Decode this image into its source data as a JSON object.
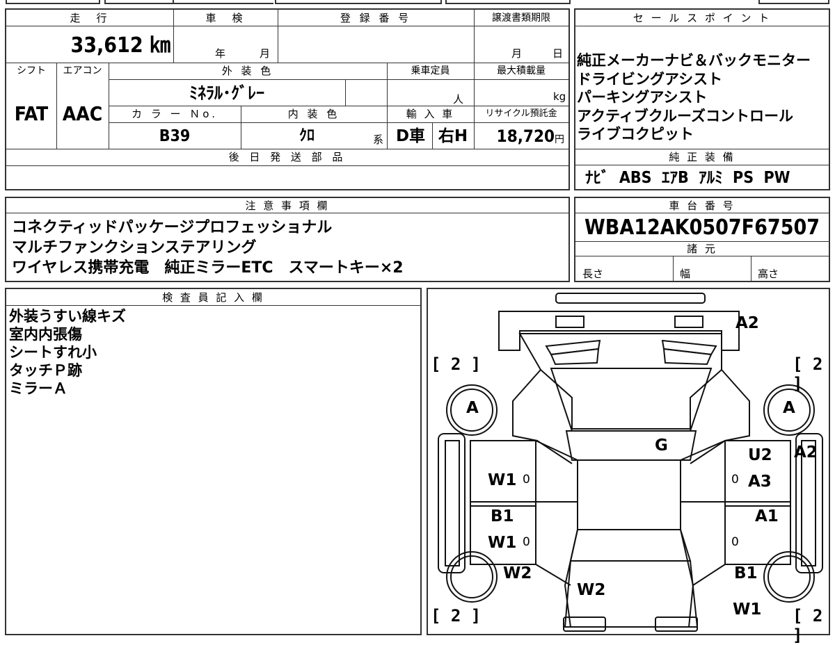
{
  "top_strip": {
    "fragment_a": "",
    "fragment_b": ""
  },
  "vehicle": {
    "mileage_label": "走　行",
    "mileage": "33,612 ㎞",
    "shaken_label": "車　検",
    "shaken_year_unit": "年",
    "shaken_month_unit": "月",
    "reg_label": "登 録 番 号",
    "transfer_label": "譲渡書類期限",
    "transfer_month_unit": "月",
    "transfer_day_unit": "日",
    "shift_label": "シフト",
    "ac_label": "エアコン",
    "ext_color_label": "外 装 色",
    "capacity_label": "乗車定員",
    "max_load_label": "最大積載量",
    "shift": "FAT",
    "ac": "AAC",
    "ext_color": "ﾐﾈﾗﾙ･ｸﾞﾚｰ",
    "capacity_unit": "人",
    "load_unit": "kg",
    "color_no_label": "カ ラ ー Ｎo.",
    "int_color_label": "内 装 色",
    "import_label": "輸 入 車",
    "recycle_label": "リサイクル預託金",
    "color_no": "B39",
    "int_color": "ｸﾛ",
    "int_color_suffix": "系",
    "import_type": "D車",
    "steering": "右H",
    "recycle_fee": "18,720",
    "recycle_unit": "円",
    "parts_label": "後 日 発 送 部 品"
  },
  "sales_points": {
    "label": "セ ー ル ス ポ イ ン ト",
    "items": [
      "純正メーカーナビ＆バックモニター",
      "ドライビングアシスト",
      "パーキングアシスト",
      "アクティブクルーズコントロール",
      "ライブコクピット"
    ],
    "equip_label": "純 正 装 備",
    "equipment": "ﾅﾋﾞ  ABS  ｴｱB  ｱﾙﾐ  PS  PW"
  },
  "notes": {
    "label": "注 意 事 項 欄",
    "lines": [
      "コネクティッドパッケージプロフェッショナル",
      "マルチファンクションステアリング",
      "ワイヤレス携帯充電　純正ミラーETC　スマートキー×2"
    ]
  },
  "chassis": {
    "label": "車 台 番 号",
    "number": "WBA12AK0507F67507",
    "spec_label": "諸 元",
    "length_label": "長さ",
    "width_label": "幅",
    "height_label": "高さ"
  },
  "inspector": {
    "label": "検 査 員 記 入 欄",
    "lines": [
      "外装うすい線キズ",
      "室内内張傷",
      "シートすれ小",
      "タッチＰ跡",
      "ミラーＡ"
    ]
  },
  "diagram": {
    "marks": {
      "rear_bumper": "A2",
      "left_bracket_top": "[ 2 ]",
      "right_bracket_top": "[ 2 ]",
      "left_bracket_bottom": "[ 2 ]",
      "right_bracket_bottom": "[ 2 ]",
      "left_mirror": "A",
      "right_mirror": "A",
      "roof": "G",
      "right_rear_door_1": "U2",
      "right_rear_door_2": "A3",
      "right_rear_fender": "A2",
      "left_rear_door": "W1",
      "left_front_door_1": "B1",
      "left_front_door_2": "W1",
      "right_front_door": "A1",
      "left_front_fender": "W2",
      "hood": "W2",
      "right_front_fender_1": "B1",
      "right_front_fender_2": "W1",
      "zero": "0"
    }
  }
}
